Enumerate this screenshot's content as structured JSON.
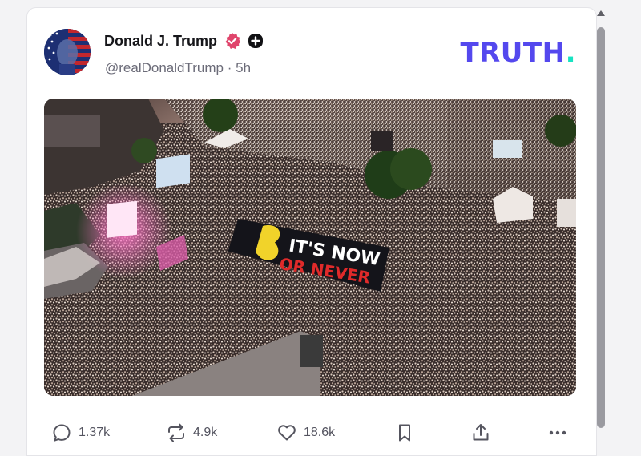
{
  "post": {
    "author": {
      "display_name": "Donald J. Trump",
      "handle": "@realDonaldTrump",
      "separator": "·",
      "time": "5h"
    },
    "brand": {
      "logo_text": "TRUTH",
      "logo_dot": ".",
      "logo_color": "#5448ee",
      "dot_color": "#17e3c2"
    },
    "media": {
      "banner_line1": "IT'S NOW",
      "banner_line2": "OR NEVER"
    },
    "actions": {
      "replies": "1.37k",
      "retruths": "4.9k",
      "likes": "18.6k"
    }
  },
  "icons": [
    "avatar",
    "verified-icon",
    "plus-badge-icon",
    "reply-icon",
    "retruth-icon",
    "like-icon",
    "bookmark-icon",
    "share-icon",
    "more-icon",
    "scroll-up-icon"
  ],
  "colors": {
    "verified": "#e0456c",
    "text_primary": "#16161a",
    "text_secondary": "#6b6b78"
  }
}
